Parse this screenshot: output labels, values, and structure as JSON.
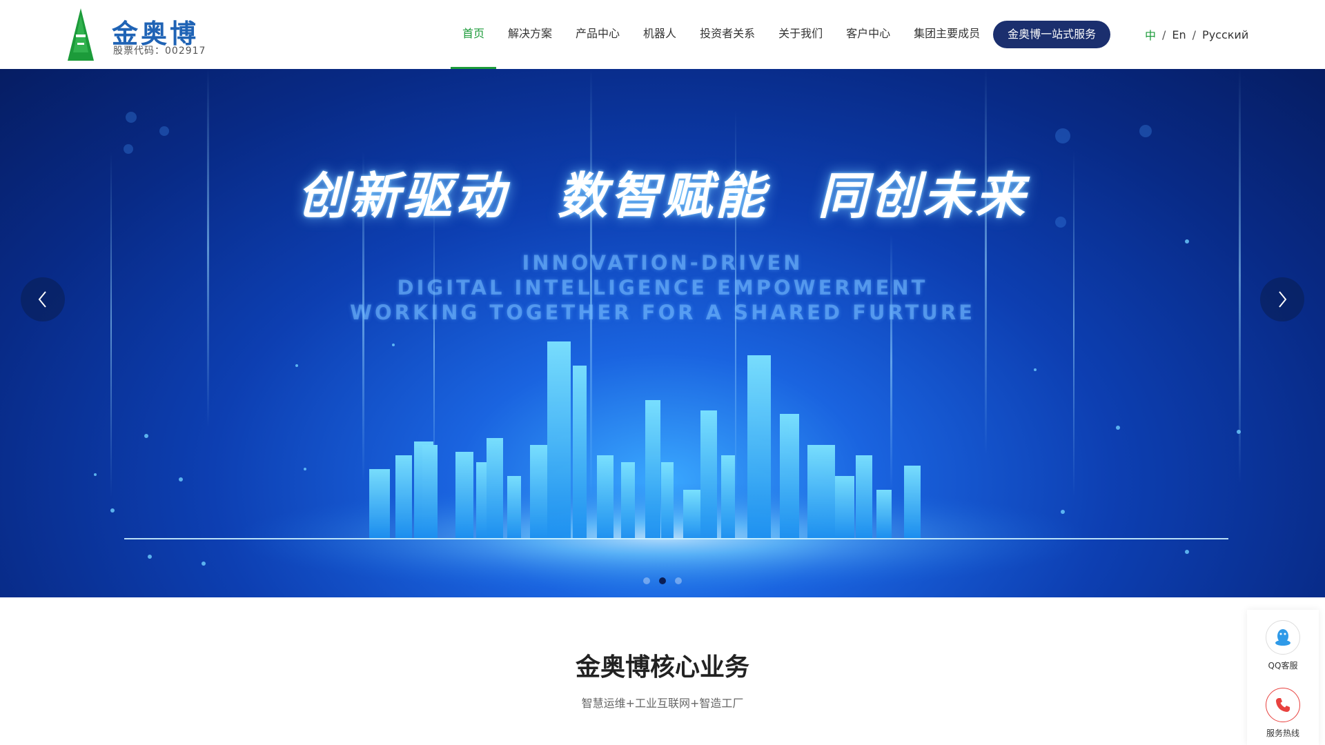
{
  "header": {
    "logo": {
      "name": "金奥博",
      "stock_code": "股票代码：002917"
    },
    "nav": [
      {
        "label": "首页",
        "active": true
      },
      {
        "label": "解决方案"
      },
      {
        "label": "产品中心"
      },
      {
        "label": "机器人"
      },
      {
        "label": "投资者关系"
      },
      {
        "label": "关于我们"
      },
      {
        "label": "客户中心"
      },
      {
        "label": "集团主要成员"
      }
    ],
    "cta_label": "金奥博一站式服务",
    "languages": {
      "zh": "中",
      "en": "En",
      "ru": "Русский",
      "separator": "/"
    }
  },
  "banner": {
    "headline": [
      "创新驱动",
      "数智赋能",
      "同创未来"
    ],
    "subtitle_lines": [
      "INNOVATION-DRIVEN",
      "DIGITAL INTELLIGENCE EMPOWERMENT",
      "WORKING TOGETHER FOR A SHARED FURTURE"
    ],
    "slides_count": 3,
    "active_slide": 2,
    "prev_icon": "chevron-left-icon",
    "next_icon": "chevron-right-icon"
  },
  "section": {
    "title": "金奥博核心业务",
    "subtitle": "智慧运维+工业互联网+智造工厂"
  },
  "sidebar": {
    "qq": {
      "label": "QQ客服",
      "icon": "qq-penguin-icon"
    },
    "hotline": {
      "label": "服务热线",
      "icon": "phone-icon"
    }
  },
  "colors": {
    "brand_green": "#1c9b3a",
    "brand_blue": "#1f63b5",
    "cta_navy": "#1b2f6e",
    "hotline_red": "#e8423f",
    "qq_blue": "#2f9ae8"
  }
}
